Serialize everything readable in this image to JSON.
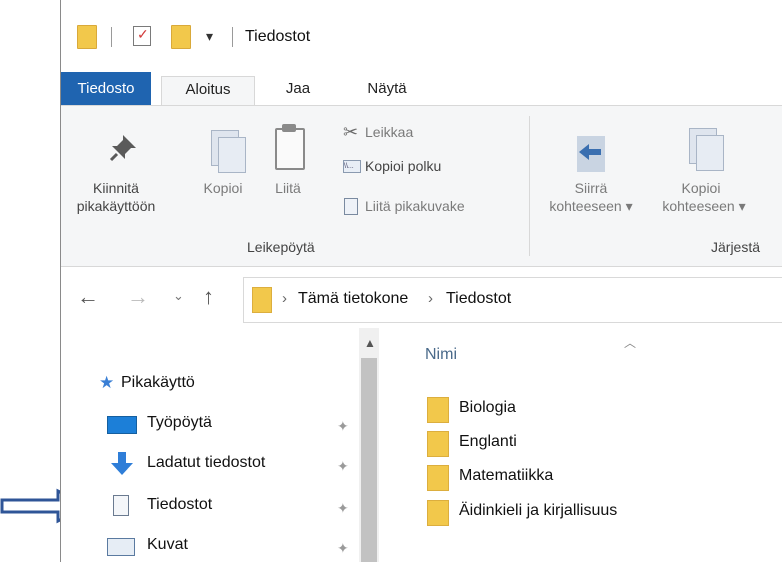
{
  "window": {
    "title": "Tiedostot"
  },
  "tabs": {
    "file": "Tiedosto",
    "home": "Aloitus",
    "share": "Jaa",
    "view": "Näytä"
  },
  "ribbon": {
    "pin_line1": "Kiinnitä",
    "pin_line2": "pikakäyttöön",
    "copy": "Kopioi",
    "paste": "Liitä",
    "cut": "Leikkaa",
    "copy_path": "Kopioi polku",
    "paste_shortcut": "Liitä pikakuvake",
    "clipboard_group": "Leikepöytä",
    "move_line1": "Siirrä",
    "move_line2": "kohteeseen",
    "copyto_line1": "Kopioi",
    "copyto_line2": "kohteeseen",
    "organize_group": "Järjestä"
  },
  "address": {
    "crumb1": "Tämä tietokone",
    "crumb2": "Tiedostot"
  },
  "navpane": {
    "quick_access": "Pikakäyttö",
    "items": [
      {
        "label": "Työpöytä",
        "icon": "desktop-icon"
      },
      {
        "label": "Ladatut tiedostot",
        "icon": "download-icon"
      },
      {
        "label": "Tiedostot",
        "icon": "documents-icon"
      },
      {
        "label": "Kuvat",
        "icon": "pictures-icon"
      }
    ]
  },
  "content": {
    "column_name": "Nimi",
    "folders": [
      "Biologia",
      "Englanti",
      "Matematiikka",
      "Äidinkieli ja kirjallisuus"
    ]
  },
  "colors": {
    "file_tab": "#1f64b0",
    "folder": "#f2c84b",
    "annotation_arrow": "#2f5597"
  }
}
